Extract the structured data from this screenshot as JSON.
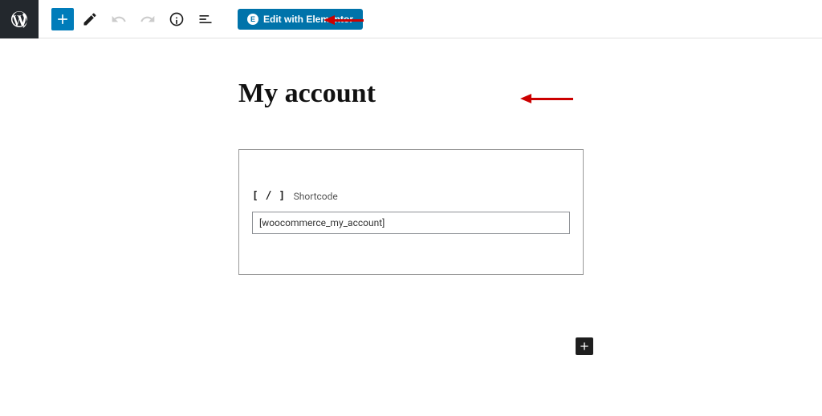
{
  "toolbar": {
    "elementor_label": "Edit with Elementor"
  },
  "page": {
    "title": "My account"
  },
  "block": {
    "name": "Shortcode",
    "value": "[woocommerce_my_account]"
  }
}
